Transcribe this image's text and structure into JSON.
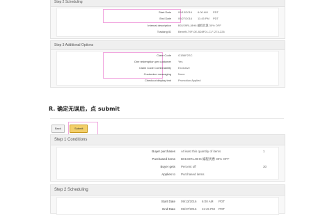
{
  "top": {
    "step2_header": "Step 2 Scheduling",
    "scheduling": [
      {
        "label": "Start Date",
        "date": "09/13/2016",
        "time": "6:00 AM",
        "tz": "PDT"
      },
      {
        "label": "End Date",
        "date": "09/27/2016",
        "time": "11:45 PM",
        "tz": "PDT"
      }
    ],
    "internal_description_label": "Internal description",
    "internal_description_value": "B01S9RLJ8H6 编程优惠 30% OFF",
    "tracking_id_label": "Tracking ID",
    "tracking_id_value": "Benefit-T9F-0E-8D8F01-C-F-274-226",
    "step3_header": "Step 3 Additional Options",
    "additional": [
      {
        "label": "Claim Code",
        "value": "G1B6F2SC"
      },
      {
        "label": "One redemption per customer",
        "value": "Yes"
      },
      {
        "label": "Claim Code Combinability",
        "value": "Exclusive"
      },
      {
        "label": "Customize messaging",
        "value": "None"
      },
      {
        "label": "Checkout display text",
        "value": "Promotion Applied"
      }
    ]
  },
  "instruction": "R. 确定无误后，点 submit",
  "toolbar": {
    "back_label": "Back",
    "submit_label": "Submit"
  },
  "bottom": {
    "step1_header": "Step 1 Conditions",
    "conditions": [
      {
        "label": "Buyer purchases",
        "value": "At least this quantity of items",
        "extra": "1"
      },
      {
        "label": "Purchased items",
        "value": "B01S9RLJ8H6 编程优惠 30% OFF",
        "extra": ""
      },
      {
        "label": "Buyer gets",
        "value": "Percent off",
        "extra": "30"
      },
      {
        "label": "Applies to",
        "value": "Purchased items",
        "extra": ""
      }
    ],
    "step2_header": "Step 2 Scheduling",
    "scheduling": [
      {
        "label": "Start Date",
        "date": "09/13/2016",
        "time": "6:00 AM",
        "tz": "PDT"
      },
      {
        "label": "End Date",
        "date": "09/27/2016",
        "time": "11:45 PM",
        "tz": "PDT"
      }
    ]
  },
  "colors": {
    "highlight": "#f1a7df",
    "submit_bg": "#f3cf6a",
    "panel_bg": "#f8f8f8"
  }
}
